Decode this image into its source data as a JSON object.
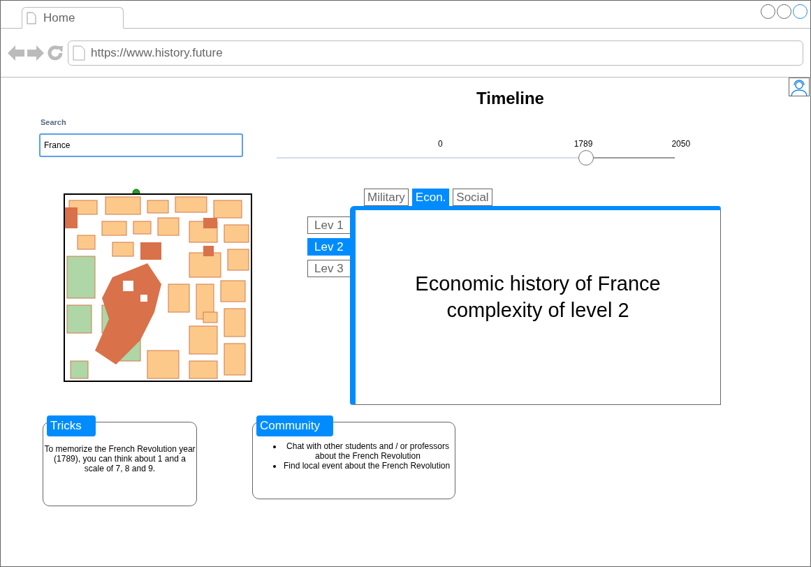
{
  "browser": {
    "tab": "Home",
    "url": "https://www.history.future"
  },
  "page": {
    "title": "Timeline"
  },
  "search": {
    "label": "Search",
    "value": "France"
  },
  "timeline": {
    "labels": [
      "0",
      "1789",
      "2050"
    ],
    "level": 0.777
  },
  "topic_tabs": [
    {
      "label": "Military",
      "selected": false
    },
    {
      "label": "Econ.",
      "selected": true
    },
    {
      "label": "Social",
      "selected": false
    }
  ],
  "level_tabs": [
    {
      "label": "Lev 1",
      "selected": false
    },
    {
      "label": "Lev 2",
      "selected": true
    },
    {
      "label": "Lev 3",
      "selected": false
    }
  ],
  "content": {
    "lines": [
      "Economic history of France",
      "complexity of level 2"
    ]
  },
  "tricks": {
    "title": "Tricks",
    "text": "To memorize the French Revolution year (1789), you can think about 1 and a scale of 7, 8 and 9."
  },
  "community": {
    "title": "Community",
    "items": [
      "Chat with other students and / or professors about the French Revolution",
      "Find local event about the French Revolution"
    ]
  }
}
